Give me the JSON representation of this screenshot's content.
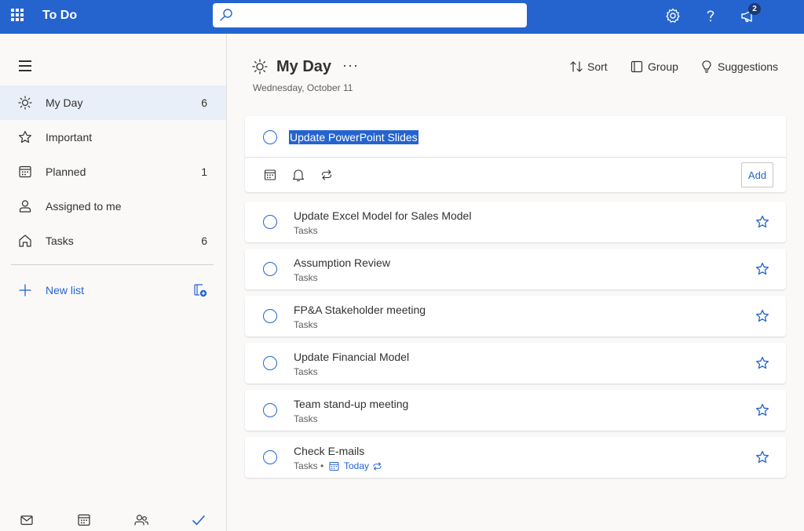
{
  "app": {
    "title": "To Do"
  },
  "search": {
    "placeholder": "",
    "value": ""
  },
  "header": {
    "notification_count": "2"
  },
  "sidebar": {
    "items": [
      {
        "label": "My Day",
        "count": "6",
        "icon": "sun-icon",
        "active": true
      },
      {
        "label": "Important",
        "count": "",
        "icon": "star-icon"
      },
      {
        "label": "Planned",
        "count": "1",
        "icon": "calendar-icon"
      },
      {
        "label": "Assigned to me",
        "count": "",
        "icon": "person-icon"
      },
      {
        "label": "Tasks",
        "count": "6",
        "icon": "home-icon"
      }
    ],
    "new_list_label": "New list",
    "bottom_icons": [
      "mail-icon",
      "calendar-icon",
      "people-icon",
      "todo-check-icon"
    ]
  },
  "main": {
    "title": "My Day",
    "date": "Wednesday, October 11",
    "toolbar": {
      "sort": "Sort",
      "group": "Group",
      "suggestions": "Suggestions"
    },
    "add_task": {
      "value": "Update PowerPoint Slides",
      "add_label": "Add"
    },
    "tasks": [
      {
        "title": "Update Excel Model for Sales Model",
        "list": "Tasks"
      },
      {
        "title": "Assumption Review",
        "list": "Tasks"
      },
      {
        "title": "FP&A Stakeholder meeting",
        "list": "Tasks"
      },
      {
        "title": "Update Financial Model",
        "list": "Tasks"
      },
      {
        "title": "Team stand-up meeting",
        "list": "Tasks"
      },
      {
        "title": "Check E-mails",
        "list": "Tasks",
        "due": "Today",
        "repeat": true
      }
    ]
  },
  "colors": {
    "accent": "#2564cf",
    "sidebar_active": "#e9eff8",
    "background": "#faf9f8"
  }
}
